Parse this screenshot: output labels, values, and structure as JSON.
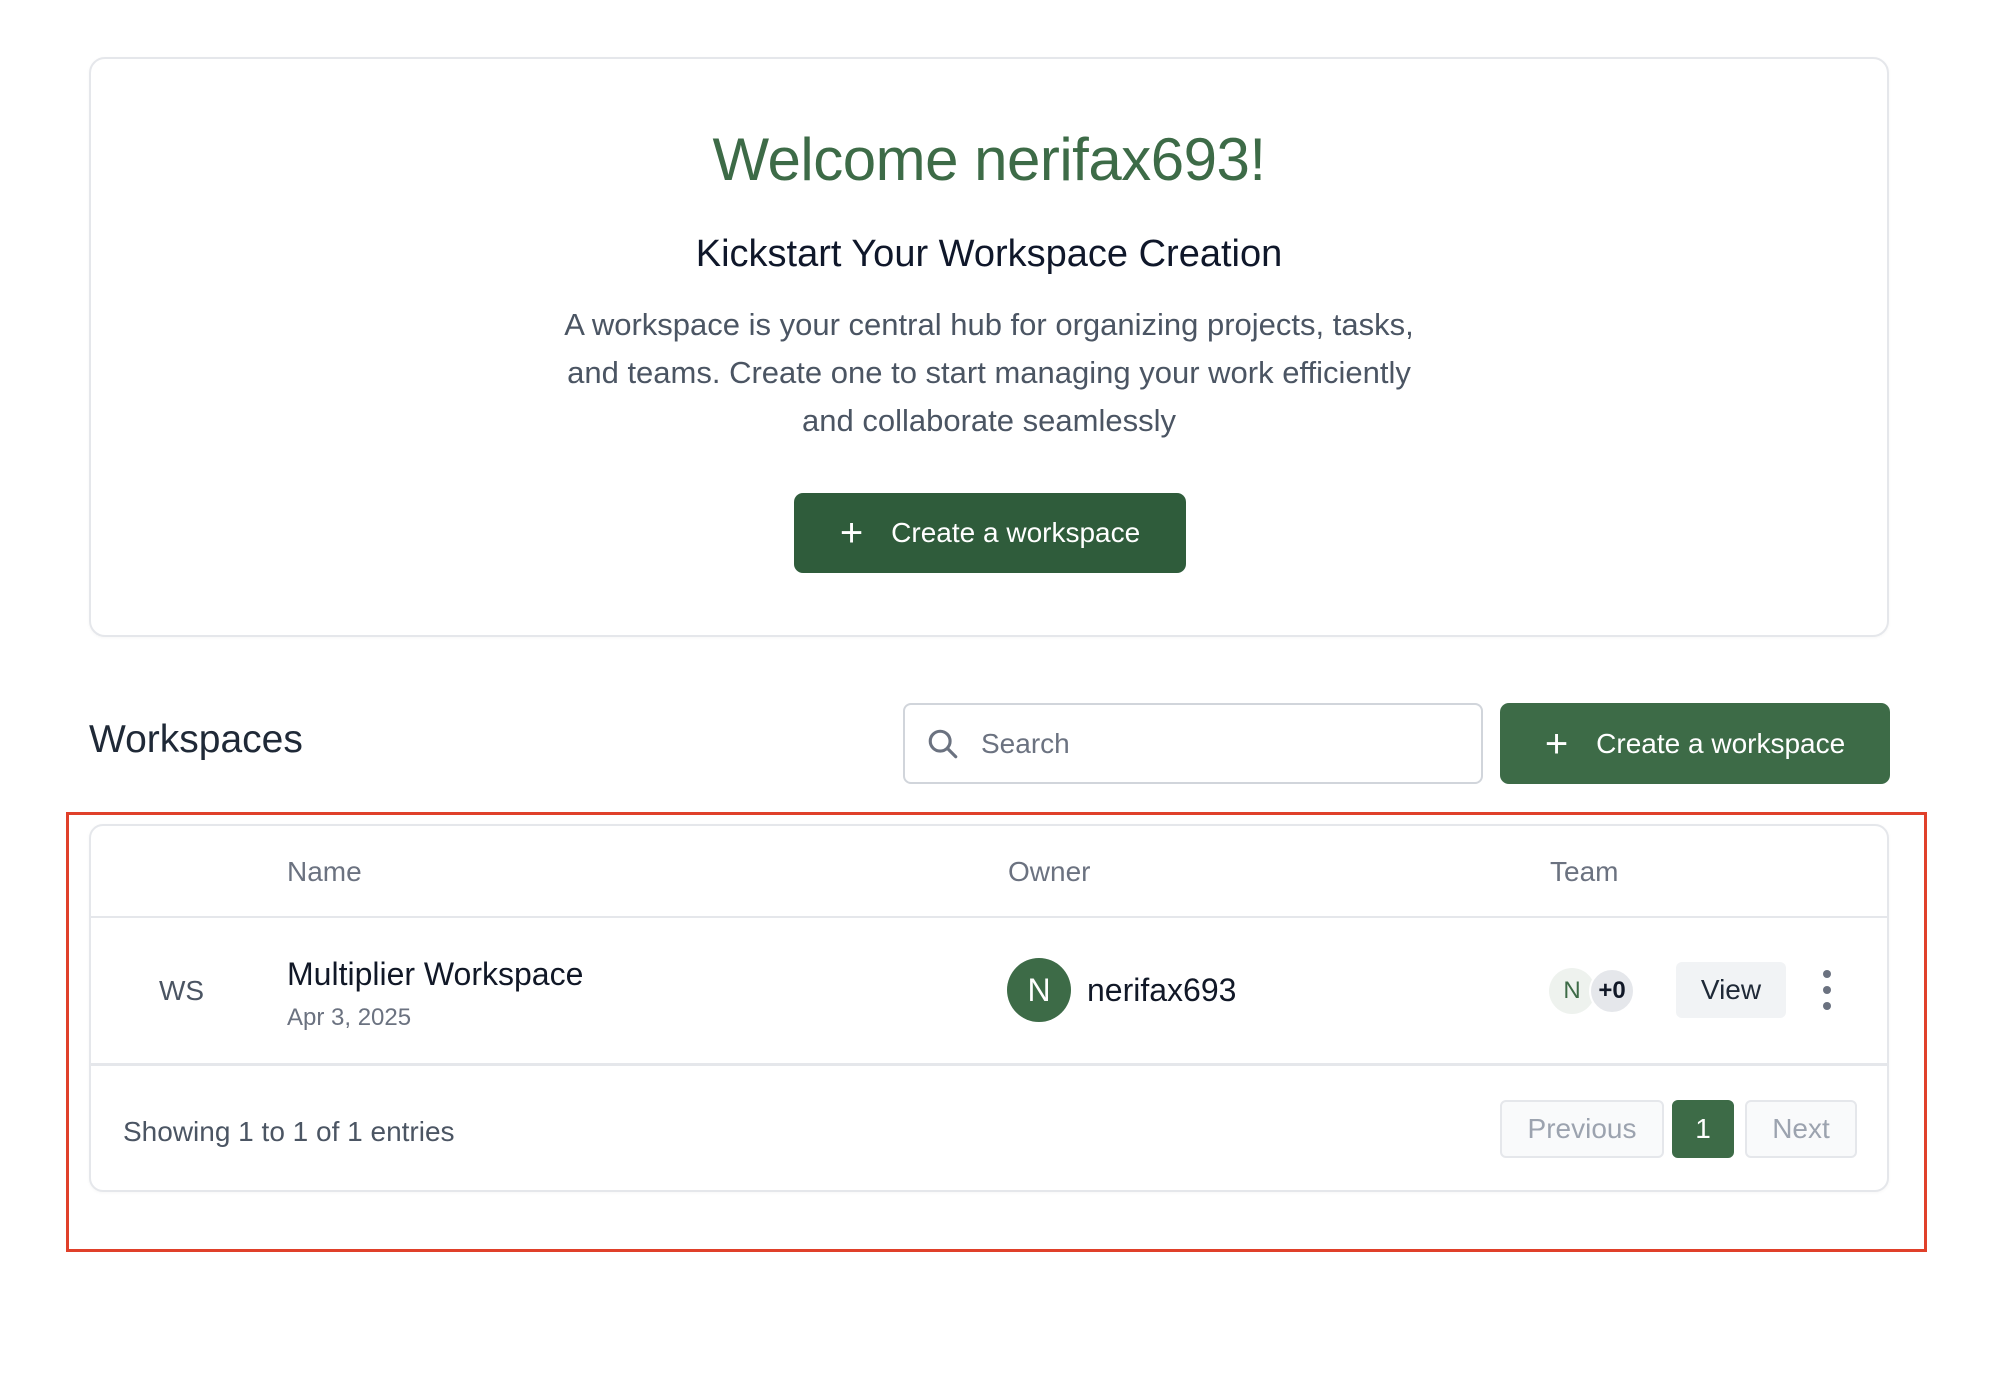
{
  "welcome": {
    "title": "Welcome nerifax693!",
    "subtitle": "Kickstart Your Workspace Creation",
    "description": "A workspace is your central hub for organizing projects, tasks, and teams. Create one to start managing your work efficiently and collaborate seamlessly",
    "create_button": "Create a workspace"
  },
  "workspaces": {
    "title": "Workspaces",
    "search_placeholder": "Search",
    "create_button": "Create a workspace",
    "columns": {
      "name": "Name",
      "owner": "Owner",
      "team": "Team"
    },
    "rows": [
      {
        "code": "WS",
        "name": "Multiplier Workspace",
        "date": "Apr 3, 2025",
        "owner_initial": "N",
        "owner_name": "nerifax693",
        "team_initial": "N",
        "team_more": "+0",
        "view_label": "View"
      }
    ],
    "entries_text": "Showing 1 to 1 of 1 entries",
    "pagination": {
      "previous": "Previous",
      "current": "1",
      "next": "Next"
    }
  },
  "icons": {
    "plus": "plus-icon",
    "search": "search-icon",
    "menu": "kebab-menu-icon"
  },
  "colors": {
    "brand": "#3d6b47",
    "brand_dark": "#2f5c3b",
    "highlight": "#e0402a"
  }
}
